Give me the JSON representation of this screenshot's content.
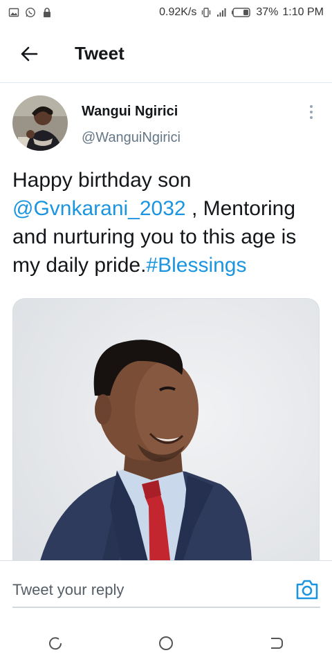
{
  "status_bar": {
    "speed": "0.92K/s",
    "battery": "37%",
    "time": "1:10 PM",
    "icons": [
      "image-icon",
      "whatsapp-icon",
      "lock-icon",
      "vibrate-icon",
      "signal-icon",
      "battery-icon"
    ]
  },
  "app_bar": {
    "title": "Tweet",
    "back_icon": "arrow-left-icon"
  },
  "tweet": {
    "author_name": "Wangui Ngirici",
    "author_handle": "@WanguiNgirici",
    "text_parts": {
      "p1": "Happy birthday son ",
      "mention": "@Gvnkarani_2032",
      "p2": " , Mentoring and nurturing you to this age is my daily pride.",
      "hashtag": "#Blessings"
    },
    "more_icon": "more-vertical-icon"
  },
  "reply": {
    "placeholder": "Tweet your reply",
    "camera_icon": "camera-icon"
  },
  "nav": {
    "icons": [
      "back-nav-icon",
      "home-nav-icon",
      "recents-nav-icon"
    ]
  },
  "colors": {
    "link": "#1b95e0",
    "text": "#14171a",
    "secondary": "#657786",
    "divider": "#e1e8ed"
  }
}
